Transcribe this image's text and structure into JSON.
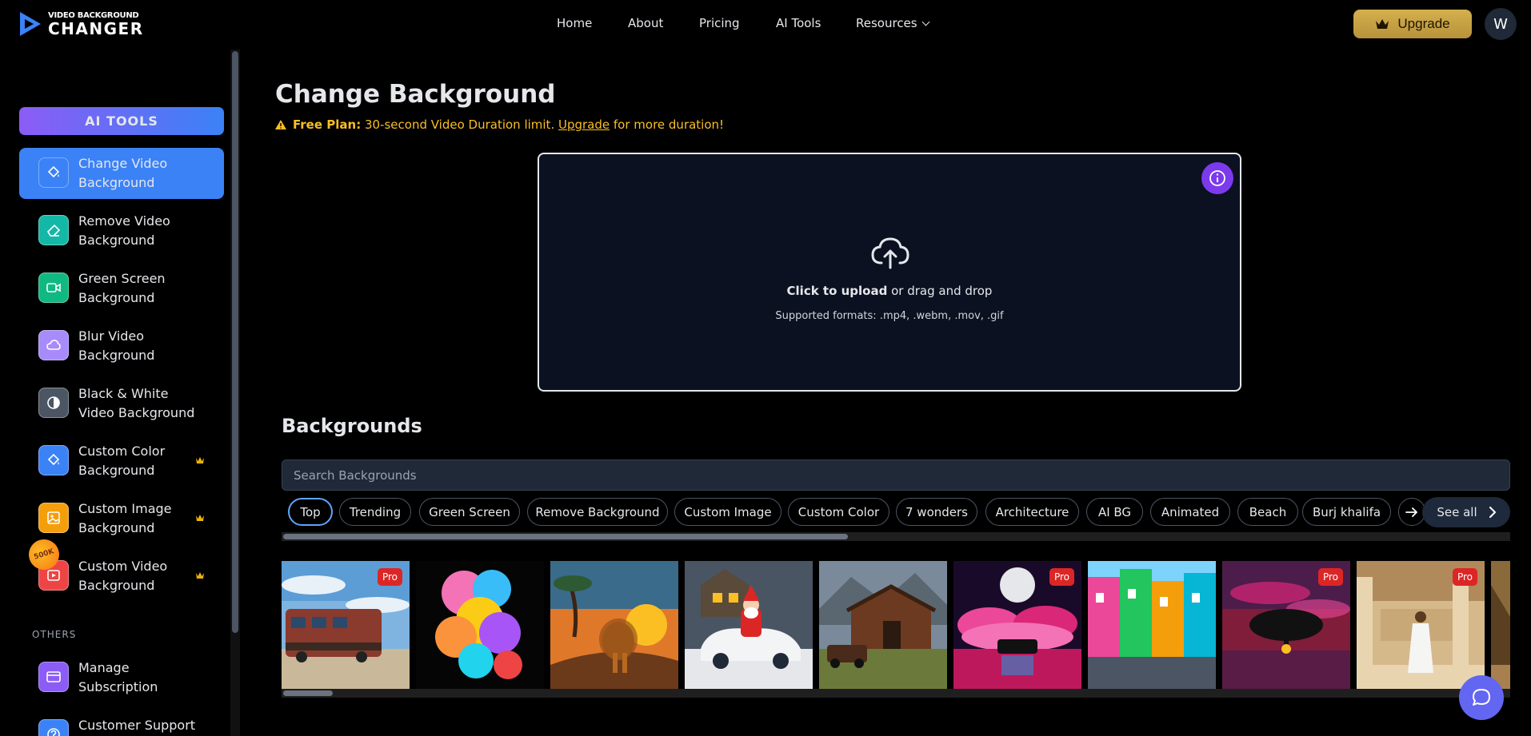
{
  "header": {
    "logo_small": "VIDEO BACKGROUND",
    "logo_big": "CHANGER",
    "nav": [
      "Home",
      "About",
      "Pricing",
      "AI Tools",
      "Resources"
    ],
    "upgrade_label": "Upgrade",
    "avatar_initial": "W"
  },
  "sidebar": {
    "section_title": "AI TOOLS",
    "items": [
      {
        "label": "Change Video Background",
        "icon": "paint-bucket-icon",
        "color": "#3b82f6",
        "active": true,
        "pro": false
      },
      {
        "label": "Remove Video Background",
        "icon": "eraser-icon",
        "color": "#14b8a6",
        "active": false,
        "pro": false
      },
      {
        "label": "Green Screen Background",
        "icon": "video-camera-icon",
        "color": "#10b981",
        "active": false,
        "pro": false
      },
      {
        "label": "Blur Video Background",
        "icon": "cloud-icon",
        "color": "#a78bfa",
        "active": false,
        "pro": false
      },
      {
        "label": "Black & White Video Background",
        "icon": "contrast-icon",
        "color": "#4b5563",
        "active": false,
        "pro": false
      },
      {
        "label": "Custom Color Background",
        "icon": "paint-bucket-icon",
        "color": "#3b82f6",
        "active": false,
        "pro": true
      },
      {
        "label": "Custom Image Background",
        "icon": "image-icon",
        "color": "#f59e0b",
        "active": false,
        "pro": true
      },
      {
        "label": "Custom Video Background",
        "icon": "video-icon",
        "color": "#ef4444",
        "active": false,
        "pro": true
      }
    ],
    "badge_text": "500K",
    "others_title": "OTHERS",
    "other_items": [
      {
        "label": "Manage Subscription",
        "icon": "card-icon",
        "color": "#8b5cf6"
      },
      {
        "label": "Customer Support",
        "icon": "help-icon",
        "color": "#3b82f6"
      }
    ]
  },
  "main": {
    "title": "Change Background",
    "plan_bold": "Free Plan:",
    "plan_text": " 30-second Video Duration limit. ",
    "plan_link": "Upgrade",
    "plan_tail": " for more duration!",
    "upload_bold": "Click to upload",
    "upload_rest": " or drag and drop",
    "formats": "Supported formats: .mp4, .webm, .mov, .gif",
    "backgrounds_title": "Backgrounds",
    "search_placeholder": "Search Backgrounds",
    "chips": [
      "Top",
      "Trending",
      "Green Screen",
      "Remove Background",
      "Custom Image",
      "Custom Color",
      "7 wonders",
      "Architecture",
      "AI BG",
      "Animated",
      "Beach",
      "Burj khalifa"
    ],
    "see_all": "See all",
    "pro_label": "Pro",
    "thumbnails": [
      {
        "name": "train",
        "pro": true
      },
      {
        "name": "color-smoke",
        "pro": false
      },
      {
        "name": "lion-sunset",
        "pro": false
      },
      {
        "name": "santa-car",
        "pro": false
      },
      {
        "name": "barn-truck",
        "pro": false
      },
      {
        "name": "pink-moon-car",
        "pro": true
      },
      {
        "name": "colorful-street",
        "pro": false
      },
      {
        "name": "red-tree",
        "pro": true
      },
      {
        "name": "ancient-ruins",
        "pro": true
      },
      {
        "name": "pyramid",
        "pro": false
      }
    ]
  }
}
